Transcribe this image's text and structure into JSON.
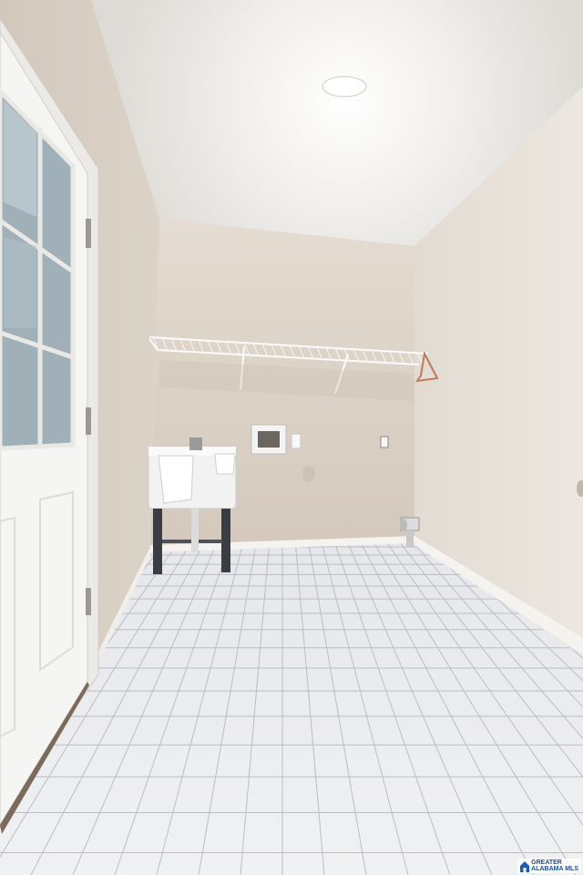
{
  "photo": {
    "scene": "laundry-room",
    "colors": {
      "ceiling": "#eceae6",
      "back_wall": "#ddd3c7",
      "left_wall": "#d8cfc3",
      "right_wall": "#e6e0d8",
      "floor": "#e9eaec",
      "grout": "#b8bcc4",
      "baseboard": "#f2f1ee",
      "door": "#f4f4f2",
      "sink": "#f1f1f1",
      "wire_shelf": "#f3f3f3",
      "accent": "#2a63b4"
    }
  },
  "watermark": {
    "line1": "GREATER",
    "line2": "ALABAMA MLS"
  }
}
